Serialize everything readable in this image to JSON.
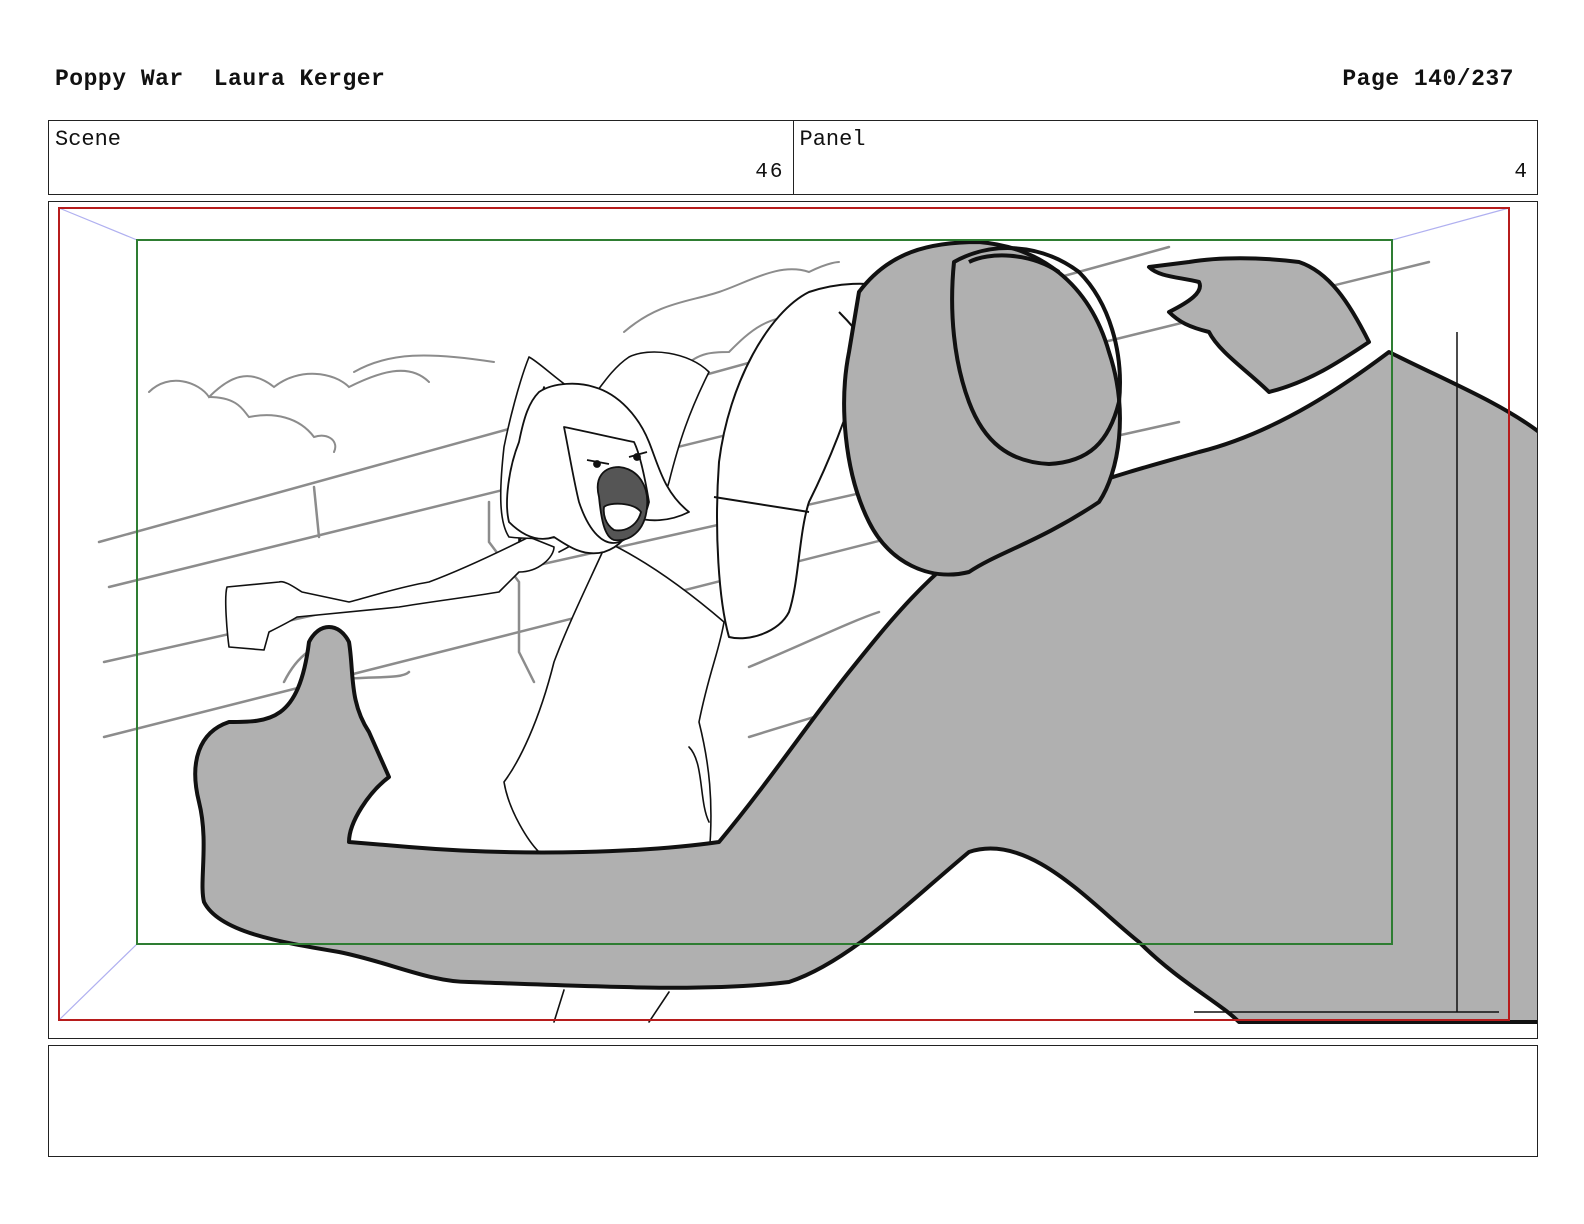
{
  "header": {
    "project": "Poppy War",
    "artist": "Laura Kerger",
    "page_label": "Page 140/237"
  },
  "meta": {
    "scene_label": "Scene",
    "scene_value": "46",
    "panel_label": "Panel",
    "panel_value": "4"
  },
  "panel": {
    "description": "Storyboard sketch: girl delivering a high kick toward a large gray figure in the foreground, wall and mountains behind",
    "colors": {
      "safe_frame": "#2e7d32",
      "outer_frame": "#b71c1c",
      "guide_lines": "#b0b0f0",
      "figure_fill": "#b0b0b0",
      "line": "#111111",
      "background_line": "#8c8c8c"
    }
  },
  "notes": {
    "text": ""
  }
}
